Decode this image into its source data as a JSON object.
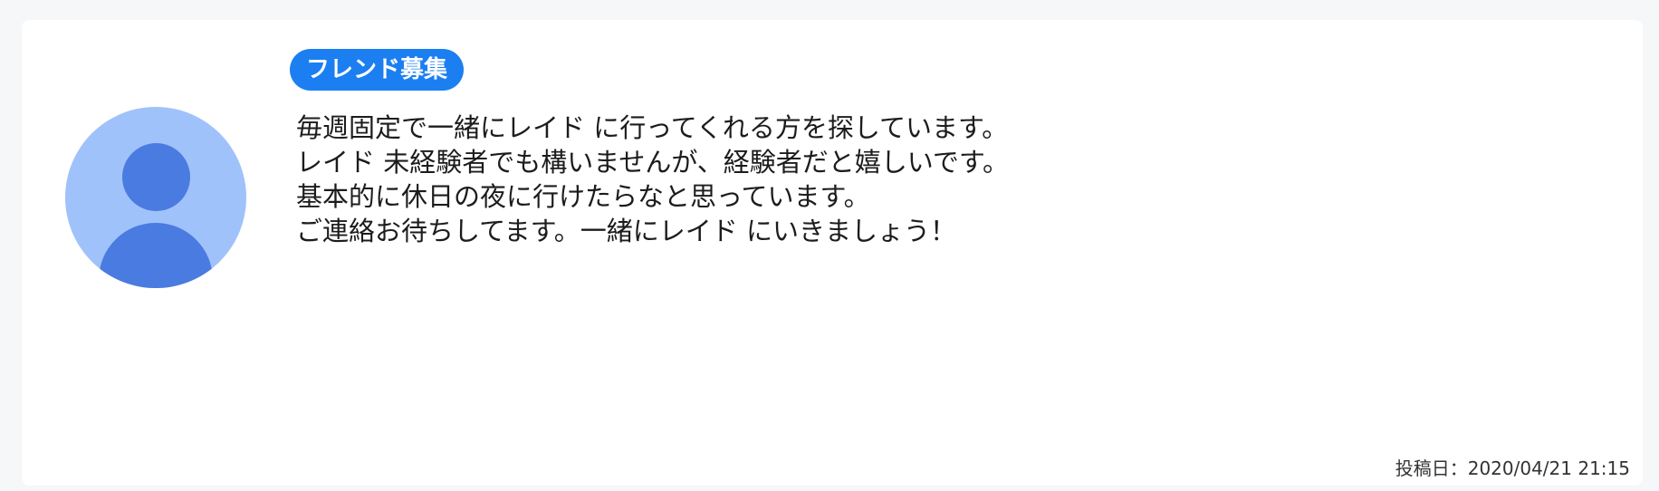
{
  "post": {
    "tag": "フレンド募集",
    "message_lines": [
      "毎週固定で一緒にレイド に行ってくれる方を探しています。",
      "レイド 未経験者でも構いませんが、経験者だと嬉しいです。",
      "基本的に休日の夜に行けたらなと思っています。",
      "ご連絡お待ちしてます。一緒にレイド にいきましょう！"
    ],
    "posted_at": "投稿日：2020/04/21 21:15"
  },
  "avatar": {
    "icon": "user-icon",
    "colors": {
      "background": "#a0c2fb",
      "figure": "#4a7be0"
    }
  },
  "colors": {
    "badge": "#1b7ff2",
    "page_background": "#f6f7f9",
    "card_background": "#ffffff"
  }
}
